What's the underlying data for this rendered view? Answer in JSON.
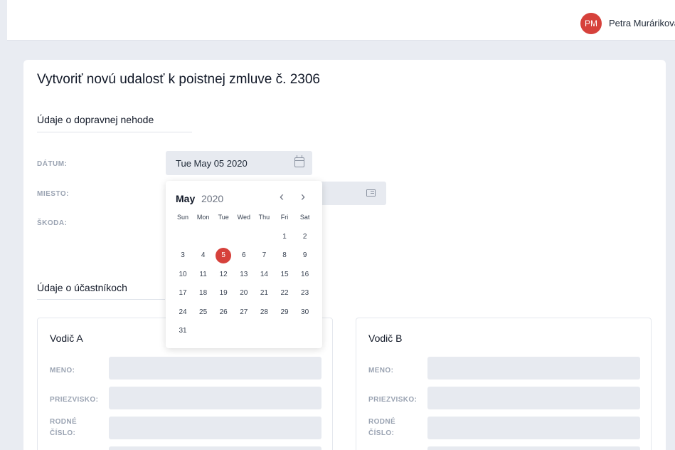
{
  "header": {
    "avatar_initials": "PM",
    "user_name": "Petra Muráriková"
  },
  "page": {
    "title": "Vytvoriť novú udalosť k poistnej zmluve č. 2306"
  },
  "accident_section": {
    "title": "Údaje o dopravnej nehode",
    "date_label": "DÁTUM:",
    "date_value": "Tue May 05 2020",
    "place_label": "MIESTO:",
    "damage_label": "ŠKODA:"
  },
  "calendar": {
    "month": "May",
    "year": "2020",
    "prev": "‹",
    "next": "›",
    "weekdays": [
      "Sun",
      "Mon",
      "Tue",
      "Wed",
      "Thu",
      "Fri",
      "Sat"
    ],
    "first_weekday_index": 5,
    "days_in_month": 31,
    "selected_day": 5
  },
  "participants_section": {
    "title": "Údaje o účastníkoch",
    "driver_a": {
      "title": "Vodič A",
      "first_name_label": "MENO:",
      "last_name_label": "PRIEZVISKO:",
      "birth_number_label_1": "RODNÉ",
      "birth_number_label_2": "ČÍSLO:"
    },
    "driver_b": {
      "title": "Vodič B",
      "first_name_label": "MENO:",
      "last_name_label": "PRIEZVISKO:",
      "birth_number_label_1": "RODNÉ",
      "birth_number_label_2": "ČÍSLO:"
    }
  },
  "colors": {
    "accent": "#d6413b",
    "background": "#e9ecf2",
    "input_bg": "#e7eaf0",
    "label": "#9aa3b2"
  }
}
